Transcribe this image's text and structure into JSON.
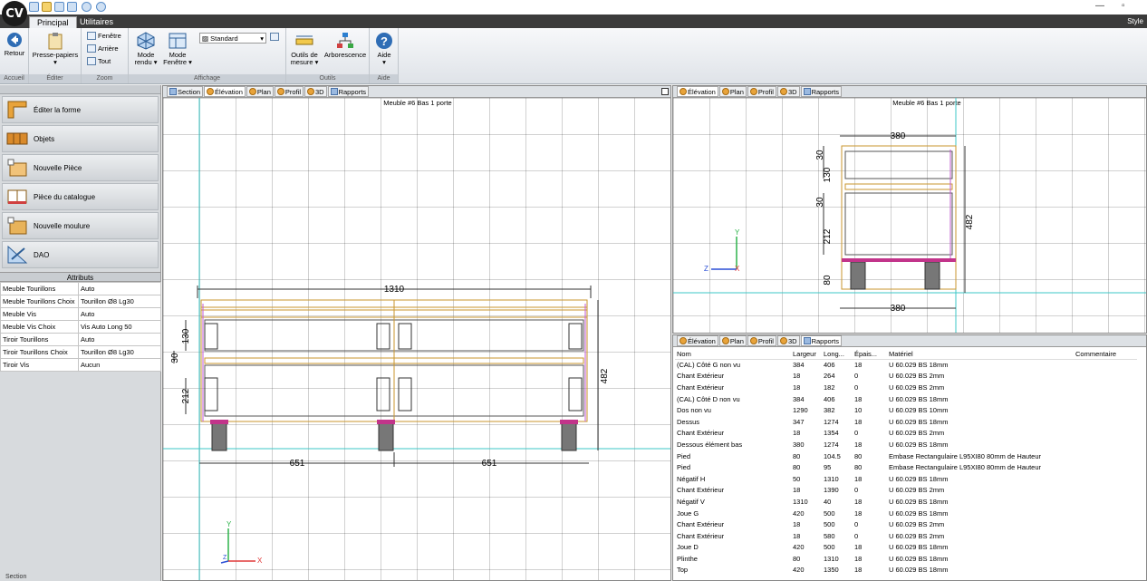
{
  "app": {
    "logo": "CV",
    "window_buttons": [
      "—",
      "▫"
    ]
  },
  "tabs": {
    "principal": "Principal",
    "utilitaires": "Utilitaires",
    "style": "Style"
  },
  "ribbon": {
    "retour": "Retour",
    "presse_papiers": "Presse-papiers",
    "fenetre": "Fenêtre",
    "arriere": "Arrière",
    "tout": "Tout",
    "mode_rendu": "Mode rendu ▾",
    "mode_fenetre": "Mode Fenêtre ▾",
    "render_select": "Standard",
    "outils_mesure": "Outils de mesure ▾",
    "arborescence": "Arborescence",
    "aide": "Aide",
    "groups": {
      "accueil": "Accueil",
      "editer": "Éditer",
      "zoom": "Zoom",
      "affichage": "Affichage",
      "outils": "Outils",
      "aide": "Aide"
    }
  },
  "left_panel": {
    "nav": [
      {
        "label": "Éditer la forme"
      },
      {
        "label": "Objets"
      },
      {
        "label": "Nouvelle Pièce"
      },
      {
        "label": "Pièce du catalogue"
      },
      {
        "label": "Nouvelle moulure"
      },
      {
        "label": "DAO"
      }
    ],
    "attributes_title": "Attributs",
    "attributes": [
      {
        "name": "Meuble Tourillons",
        "value": "Auto"
      },
      {
        "name": "Meuble Tourillons Choix",
        "value": "Tourillon Ø8 Lg30"
      },
      {
        "name": "Meuble Vis",
        "value": "Auto"
      },
      {
        "name": "Meuble Vis Choix",
        "value": "Vis Auto Long 50"
      },
      {
        "name": "Tiroir Tourillons",
        "value": "Auto"
      },
      {
        "name": "Tiroir Tourillons Choix",
        "value": "Tourillon Ø8 Lg30"
      },
      {
        "name": "Tiroir Vis",
        "value": "Aucun"
      }
    ],
    "footer": "Section"
  },
  "main_view": {
    "tabs": [
      "Section",
      "Élévation",
      "Plan",
      "Profil",
      "3D",
      "Rapports"
    ],
    "caption": "Meuble #6 Bas 1 porte",
    "dims": {
      "width": "1310",
      "left_half": "651",
      "right_half": "651",
      "height": "482",
      "d130": "130",
      "d30": "30",
      "d212": "212"
    },
    "axis_x": "X",
    "axis_y": "Y",
    "axis_z": "Z"
  },
  "side_view": {
    "tabs": [
      "Élévation",
      "Plan",
      "Profil",
      "3D",
      "Rapports"
    ],
    "caption": "Meuble #6 Bas 1 porte",
    "dims": {
      "top": "380",
      "bottom": "380",
      "height": "482",
      "d30a": "30",
      "d130": "130",
      "d30b": "30",
      "d212": "212",
      "d80": "80"
    }
  },
  "report": {
    "tabs": [
      "Élévation",
      "Plan",
      "Profil",
      "3D",
      "Rapports"
    ],
    "columns": [
      "Nom",
      "Largeur",
      "Long...",
      "Épais...",
      "Matériel",
      "Commentaire"
    ],
    "rows": [
      [
        "(CAL) Côté G non vu",
        "384",
        "406",
        "18",
        "U 60.029 BS 18mm"
      ],
      [
        "Chant Extérieur",
        "18",
        "264",
        "0",
        "U 60.029 BS 2mm"
      ],
      [
        "Chant Extérieur",
        "18",
        "182",
        "0",
        "U 60.029 BS 2mm"
      ],
      [
        "(CAL) Côté D non vu",
        "384",
        "406",
        "18",
        "U 60.029 BS 18mm"
      ],
      [
        "Dos non vu",
        "1290",
        "382",
        "10",
        "U 60.029 BS 10mm"
      ],
      [
        "Dessus",
        "347",
        "1274",
        "18",
        "U 60.029 BS 18mm"
      ],
      [
        "Chant Extérieur",
        "18",
        "1354",
        "0",
        "U 60.029 BS 2mm"
      ],
      [
        "Dessous élément bas",
        "380",
        "1274",
        "18",
        "U 60.029 BS 18mm"
      ],
      [
        "Pied",
        "80",
        "104.5",
        "80",
        "Embase Rectangulaire L95XI80  80mm de Hauteur"
      ],
      [
        "Pied",
        "80",
        "95",
        "80",
        "Embase Rectangulaire L95XI80  80mm de Hauteur"
      ],
      [
        "Négatif H",
        "50",
        "1310",
        "18",
        "U 60.029 BS 18mm"
      ],
      [
        "Chant Extérieur",
        "18",
        "1390",
        "0",
        "U 60.029 BS 2mm"
      ],
      [
        "Négatif V",
        "1310",
        "40",
        "18",
        "U 60.029 BS 18mm"
      ],
      [
        "Joue G",
        "420",
        "500",
        "18",
        "U 60.029 BS 18mm"
      ],
      [
        "Chant Extérieur",
        "18",
        "500",
        "0",
        "U 60.029 BS 2mm"
      ],
      [
        "Chant Extérieur",
        "18",
        "580",
        "0",
        "U 60.029 BS 2mm"
      ],
      [
        "Joue D",
        "420",
        "500",
        "18",
        "U 60.029 BS 18mm"
      ],
      [
        "Plinthe",
        "80",
        "1310",
        "18",
        "U 60.029 BS 18mm"
      ],
      [
        "Top",
        "420",
        "1350",
        "18",
        "U 60.029 BS 18mm"
      ]
    ]
  }
}
